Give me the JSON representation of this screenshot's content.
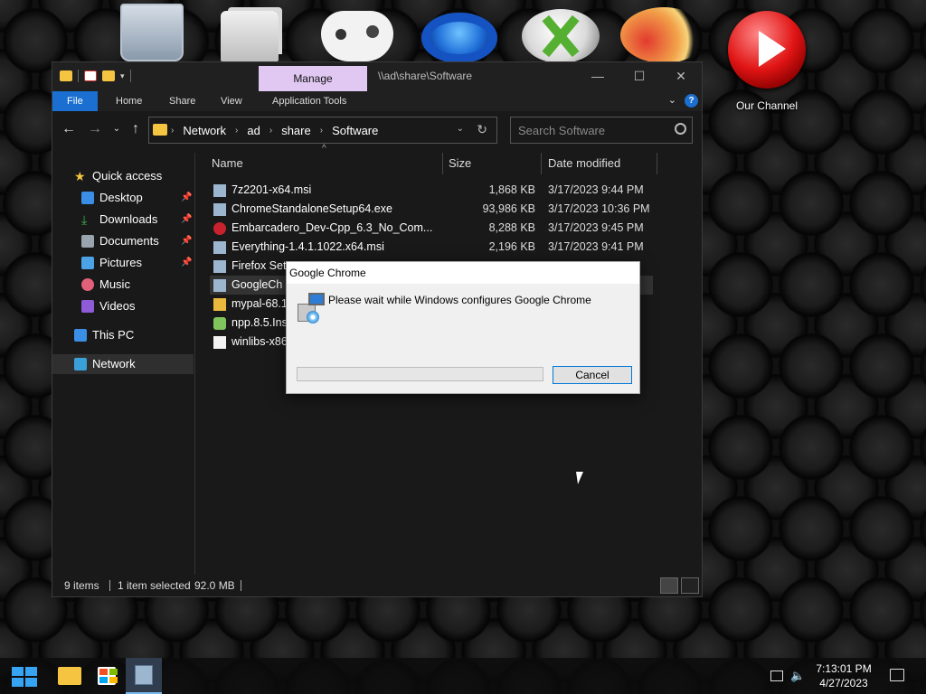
{
  "desktop": {
    "icons": [
      {
        "name": "recycle-bin",
        "label": ""
      },
      {
        "name": "folders",
        "label": ""
      },
      {
        "name": "xbox-controller",
        "label": ""
      },
      {
        "name": "steam",
        "label": ""
      },
      {
        "name": "xbox",
        "label": ""
      },
      {
        "name": "phoenix-game",
        "label": ""
      },
      {
        "name": "our-channel",
        "label": "Our Channel"
      }
    ]
  },
  "explorer": {
    "title_path": "\\\\ad\\share\\Software",
    "manage_tab": "Manage",
    "window_buttons": {
      "minimize": "—",
      "maximize": "☐",
      "close": "✕"
    },
    "ribbon_tabs": [
      "File",
      "Home",
      "Share",
      "View",
      "Application Tools"
    ],
    "help_glyph": "?",
    "breadcrumb": [
      "Network",
      "ad",
      "share",
      "Software"
    ],
    "search_placeholder": "Search Software",
    "sidebar": [
      {
        "label": "Quick access",
        "icon": "star-icon",
        "pinned": false
      },
      {
        "label": "Desktop",
        "icon": "desktop-icon",
        "pinned": true
      },
      {
        "label": "Downloads",
        "icon": "download-icon",
        "pinned": true
      },
      {
        "label": "Documents",
        "icon": "documents-icon",
        "pinned": true
      },
      {
        "label": "Pictures",
        "icon": "pictures-icon",
        "pinned": true
      },
      {
        "label": "Music",
        "icon": "music-icon",
        "pinned": false
      },
      {
        "label": "Videos",
        "icon": "videos-icon",
        "pinned": false
      },
      {
        "label": "This PC",
        "icon": "computer-icon",
        "pinned": false
      },
      {
        "label": "Network",
        "icon": "network-icon",
        "pinned": false,
        "selected": true
      }
    ],
    "columns": {
      "name": "Name",
      "size": "Size",
      "date": "Date modified"
    },
    "files": [
      {
        "name": "7z2201-x64.msi",
        "size": "1,868 KB",
        "date": "3/17/2023 9:44 PM",
        "icon": "msi-icon"
      },
      {
        "name": "ChromeStandaloneSetup64.exe",
        "size": "93,986 KB",
        "date": "3/17/2023 10:36 PM",
        "icon": "chrome-installer-icon"
      },
      {
        "name": "Embarcadero_Dev-Cpp_6.3_No_Com...",
        "size": "8,288 KB",
        "date": "3/17/2023 9:45 PM",
        "icon": "devcpp-icon"
      },
      {
        "name": "Everything-1.4.1.1022.x64.msi",
        "size": "2,196 KB",
        "date": "3/17/2023 9:41 PM",
        "icon": "msi-icon"
      },
      {
        "name": "Firefox Set",
        "size": "",
        "date": "",
        "icon": "msi-icon"
      },
      {
        "name": "GoogleCh",
        "size": "",
        "date": "",
        "icon": "msi-icon",
        "selected": true
      },
      {
        "name": "mypal-68.1",
        "size": "",
        "date": "",
        "icon": "folder-zip-icon"
      },
      {
        "name": "npp.8.5.Ins",
        "size": "",
        "date": "",
        "icon": "notepadpp-icon"
      },
      {
        "name": "winlibs-x86",
        "size": "",
        "date": "",
        "icon": "file-icon"
      }
    ],
    "status": {
      "items": "9 items",
      "selected": "1 item selected",
      "size": "92.0 MB"
    }
  },
  "dialog": {
    "title": "Google Chrome",
    "message": "Please wait while Windows configures Google Chrome",
    "cancel_label": "Cancel",
    "progress": 0
  },
  "taskbar": {
    "time": "7:13:01 PM",
    "date": "4/27/2023",
    "pinned": [
      "start-button",
      "file-explorer",
      "microsoft-store",
      "installer"
    ]
  },
  "colors": {
    "accent": "#1a6fd1",
    "manage_tab": "#e1c8f2",
    "dialog_bg": "#f0f0f0"
  }
}
